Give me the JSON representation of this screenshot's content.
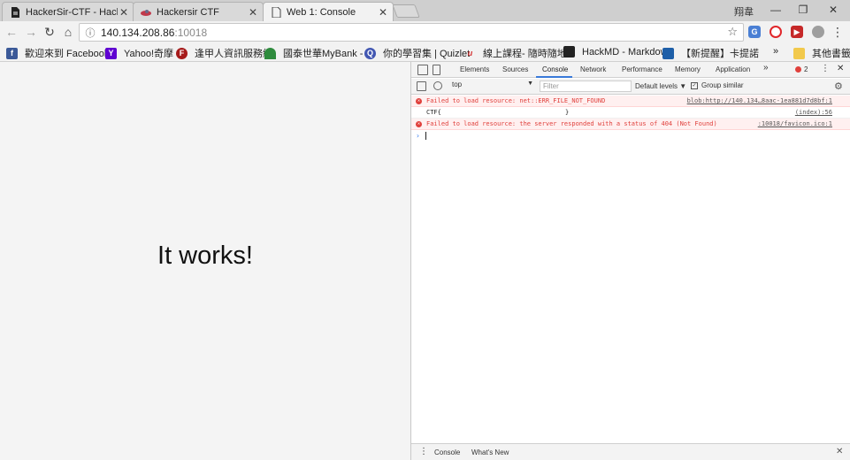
{
  "tabs": [
    {
      "title": "HackerSir-CTF - HackM",
      "icon": "document-icon",
      "active": false
    },
    {
      "title": "Hackersir CTF",
      "icon": "hackersir-logo-icon",
      "active": false
    },
    {
      "title": "Web 1: Console",
      "icon": "document-icon",
      "active": true
    }
  ],
  "window": {
    "user": "翔韋"
  },
  "address": {
    "host": "140.134.208.86",
    "port": ":10018"
  },
  "bookmarks": [
    {
      "label": "歡迎來到 Facebook",
      "icon_text": "f",
      "color": "#3b5998"
    },
    {
      "label": "Yahoo!奇摩",
      "icon_text": "Y",
      "color": "#5f01d1"
    },
    {
      "label": "逢甲人資訊服務網",
      "icon_text": "F",
      "color": "#a61b1b"
    },
    {
      "label": "國泰世華MyBank -",
      "icon_text": "",
      "color": "#2e8b3d"
    },
    {
      "label": "你的學習集 | Quizlet",
      "icon_text": "Q",
      "color": "#4257b2"
    },
    {
      "label": "線上課程- 隨時隨地",
      "icon_text": "u",
      "color": "#d32f2f"
    },
    {
      "label": "HackMD - Markdow",
      "icon_text": "",
      "color": "#222222"
    },
    {
      "label": "【新提醒】卡提諾",
      "icon_text": "",
      "color": "#1e5fa8"
    }
  ],
  "bookmarks_more": "»",
  "bookmarks_other": "其他書籤",
  "page": {
    "heading": "It works!"
  },
  "devtools": {
    "tabs": [
      "Elements",
      "Sources",
      "Console",
      "Network",
      "Performance",
      "Memory",
      "Application"
    ],
    "more": "»",
    "error_count": "2",
    "context": "top",
    "filter_placeholder": "Filter",
    "levels": "Default levels ▼",
    "group_similar": "Group similar",
    "messages": [
      {
        "type": "error",
        "text": "Failed to load resource: net::ERR_FILE_NOT_FOUND",
        "source": "blob:http://140.134…8aac-1ea881d7d8bf:1"
      },
      {
        "type": "log",
        "text": "CTF{",
        "close": "}",
        "source": "(index):56"
      },
      {
        "type": "error",
        "text": "Failed to load resource: the server responded with a status of 404 (Not Found)",
        "source": ":10018/favicon.ico:1"
      }
    ],
    "prompt": "›",
    "drawer_tabs": [
      "Console",
      "What's New"
    ]
  }
}
